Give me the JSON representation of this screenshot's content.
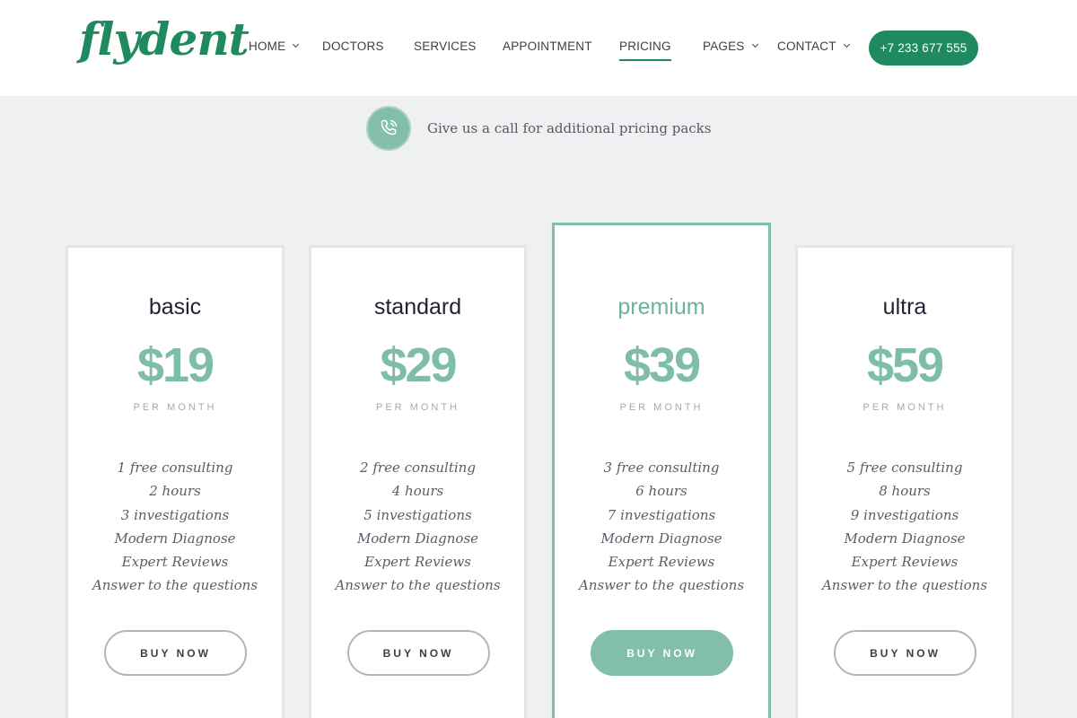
{
  "brand": {
    "logo_text": "flydent",
    "accent": "#1f8a5f",
    "accent_light": "#83bfa8"
  },
  "nav": {
    "items": [
      {
        "label": "HOME",
        "dropdown": true
      },
      {
        "label": "DOCTORS",
        "dropdown": false
      },
      {
        "label": "SERVICES",
        "dropdown": false
      },
      {
        "label": "APPOINTMENT",
        "dropdown": false
      },
      {
        "label": "PRICING",
        "dropdown": false,
        "active": true
      },
      {
        "label": "PAGES",
        "dropdown": true
      },
      {
        "label": "CONTACT",
        "dropdown": true
      }
    ],
    "phone_button": "+7 233 677 555"
  },
  "callbar": {
    "icon": "phone-icon",
    "text": "Give us a call for additional pricing packs"
  },
  "plans": [
    {
      "name": "basic",
      "price": "$19",
      "period": "PER MONTH",
      "featured": false,
      "features": [
        "1 free consulting",
        "2 hours",
        "3 investigations",
        "Modern Diagnose",
        "Expert Reviews",
        "Answer to the questions"
      ],
      "button": "BUY NOW"
    },
    {
      "name": "standard",
      "price": "$29",
      "period": "PER MONTH",
      "featured": false,
      "features": [
        "2 free consulting",
        "4 hours",
        "5 investigations",
        "Modern Diagnose",
        "Expert Reviews",
        "Answer to the questions"
      ],
      "button": "BUY NOW"
    },
    {
      "name": "premium",
      "price": "$39",
      "period": "PER MONTH",
      "featured": true,
      "features": [
        "3 free consulting",
        "6 hours",
        "7 investigations",
        "Modern Diagnose",
        "Expert Reviews",
        "Answer to the questions"
      ],
      "button": "BUY NOW"
    },
    {
      "name": "ultra",
      "price": "$59",
      "period": "PER MONTH",
      "featured": false,
      "features": [
        "5 free consulting",
        "8 hours",
        "9 investigations",
        "Modern Diagnose",
        "Expert Reviews",
        "Answer to the questions"
      ],
      "button": "BUY NOW"
    }
  ]
}
